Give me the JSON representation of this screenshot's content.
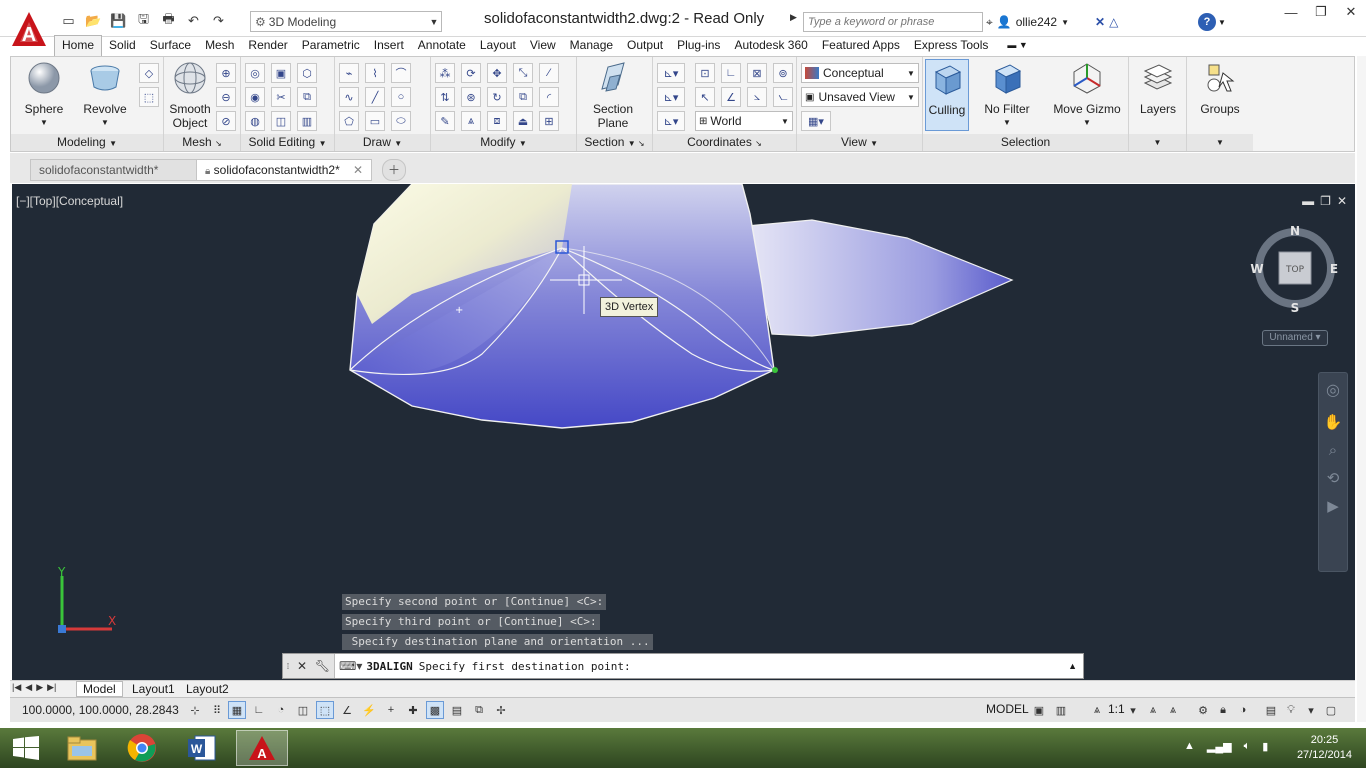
{
  "title_bar": {
    "workspace": "3D Modeling",
    "document_title": "solidofaconstantwidth2.dwg:2 - Read Only",
    "search_placeholder": "Type a keyword or phrase",
    "username": "ollie242"
  },
  "ribbon_tabs": [
    "Home",
    "Solid",
    "Surface",
    "Mesh",
    "Render",
    "Parametric",
    "Insert",
    "Annotate",
    "Layout",
    "View",
    "Manage",
    "Output",
    "Plug-ins",
    "Autodesk 360",
    "Featured Apps",
    "Express Tools"
  ],
  "ribbon": {
    "modeling": {
      "label": "Modeling",
      "sphere": "Sphere",
      "revolve": "Revolve"
    },
    "mesh": {
      "label": "Mesh",
      "smooth_object_1": "Smooth",
      "smooth_object_2": "Object"
    },
    "solid_editing": {
      "label": "Solid Editing"
    },
    "draw": {
      "label": "Draw"
    },
    "modify": {
      "label": "Modify"
    },
    "section": {
      "label": "Section",
      "plane_1": "Section",
      "plane_2": "Plane"
    },
    "coordinates": {
      "label": "Coordinates",
      "ucs_value": "World"
    },
    "view": {
      "label": "View",
      "visual_style": "Conceptual",
      "named_view": "Unsaved View"
    },
    "selection": {
      "label": "Selection",
      "culling": "Culling",
      "no_filter": "No Filter",
      "move_gizmo": "Move Gizmo"
    },
    "layers": {
      "label": "Layers"
    },
    "groups": {
      "label": "Groups"
    }
  },
  "doc_tabs": [
    "solidofaconstantwidth*",
    "solidofaconstantwidth2*"
  ],
  "viewport": {
    "label": "[−][Top][Conceptual]",
    "tooltip": "3D Vertex",
    "viewcube": {
      "n": "N",
      "s": "S",
      "e": "E",
      "w": "W",
      "face": "TOP"
    },
    "ucs_dropdown": "Unnamed",
    "axis_y": "Y",
    "axis_x": "X"
  },
  "command": {
    "history": [
      "Specify second point or [Continue] <C>:",
      "Specify third point or [Continue] <C>:",
      " Specify destination plane and orientation ..."
    ],
    "name": "3DALIGN",
    "prompt": "Specify first destination point:"
  },
  "layout_tabs": [
    "Model",
    "Layout1",
    "Layout2"
  ],
  "status": {
    "coords": "100.0000, 100.0000, 28.2843",
    "model": "MODEL",
    "scale": "1:1"
  },
  "clock": {
    "time": "20:25",
    "date": "27/12/2014"
  },
  "colors": {
    "viewport_bg": "#212a36",
    "ribbon_bg": "#f3f3f3",
    "autocad_red": "#c8141a",
    "solid_blue": "#4c4fc9",
    "solid_cream": "#f8f7d8"
  }
}
